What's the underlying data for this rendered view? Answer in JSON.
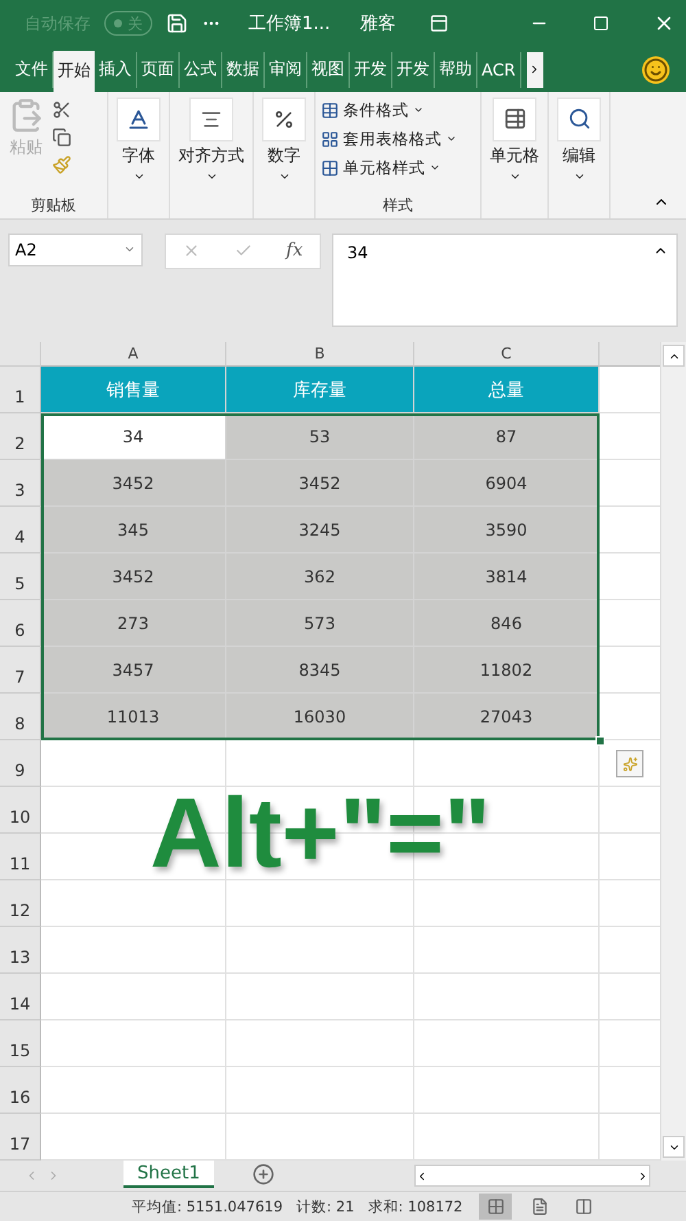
{
  "title_bar": {
    "autosave_label": "自动保存",
    "autosave_toggle": {
      "label": "关",
      "on": false
    },
    "title": "工作簿1...",
    "user": "雅客"
  },
  "ribbon_tabs": [
    {
      "label": "文件",
      "selected": false
    },
    {
      "label": "开始",
      "selected": true
    },
    {
      "label": "插入",
      "selected": false
    },
    {
      "label": "页面",
      "selected": false
    },
    {
      "label": "公式",
      "selected": false
    },
    {
      "label": "数据",
      "selected": false
    },
    {
      "label": "审阅",
      "selected": false
    },
    {
      "label": "视图",
      "selected": false
    },
    {
      "label": "开发",
      "selected": false
    },
    {
      "label": "开发",
      "selected": false
    },
    {
      "label": "帮助",
      "selected": false
    },
    {
      "label": "ACR",
      "selected": false
    }
  ],
  "ribbon": {
    "clipboard": {
      "paste": {
        "label": "粘贴",
        "disabled": true
      },
      "group_label": "剪贴板"
    },
    "big_buttons": [
      {
        "kind": "font",
        "label": "字体"
      },
      {
        "kind": "align",
        "label": "对齐方式"
      },
      {
        "kind": "number",
        "label": "数字"
      }
    ],
    "styles": {
      "items": [
        "条件格式",
        "套用表格格式",
        "单元格样式"
      ],
      "group_label": "样式"
    },
    "big_buttons_right": [
      {
        "kind": "cells",
        "label": "单元格"
      },
      {
        "kind": "edit",
        "label": "编辑"
      }
    ]
  },
  "formula_bar": {
    "name_box": "A2",
    "fx": "fx",
    "value": "34"
  },
  "columns": [
    "A",
    "B",
    "C"
  ],
  "rows": [
    {
      "number": "1",
      "kind": "header",
      "cells": [
        {
          "text": "销售量"
        },
        {
          "text": "库存量"
        },
        {
          "text": "总量"
        }
      ]
    },
    {
      "number": "2",
      "kind": "data",
      "cells": [
        {
          "text": "34",
          "selected": true,
          "active": true
        },
        {
          "text": "53",
          "selected": true,
          "active": false
        },
        {
          "text": "87",
          "selected": true,
          "active": false
        }
      ]
    },
    {
      "number": "3",
      "kind": "data",
      "cells": [
        {
          "text": "3452",
          "selected": true,
          "active": false
        },
        {
          "text": "3452",
          "selected": true,
          "active": false
        },
        {
          "text": "6904",
          "selected": true,
          "active": false
        }
      ]
    },
    {
      "number": "4",
      "kind": "data",
      "cells": [
        {
          "text": "345",
          "selected": true,
          "active": false
        },
        {
          "text": "3245",
          "selected": true,
          "active": false
        },
        {
          "text": "3590",
          "selected": true,
          "active": false
        }
      ]
    },
    {
      "number": "5",
      "kind": "data",
      "cells": [
        {
          "text": "3452",
          "selected": true,
          "active": false
        },
        {
          "text": "362",
          "selected": true,
          "active": false
        },
        {
          "text": "3814",
          "selected": true,
          "active": false
        }
      ]
    },
    {
      "number": "6",
      "kind": "data",
      "cells": [
        {
          "text": "273",
          "selected": true,
          "active": false
        },
        {
          "text": "573",
          "selected": true,
          "active": false
        },
        {
          "text": "846",
          "selected": true,
          "active": false
        }
      ]
    },
    {
      "number": "7",
      "kind": "data",
      "cells": [
        {
          "text": "3457",
          "selected": true,
          "active": false
        },
        {
          "text": "8345",
          "selected": true,
          "active": false
        },
        {
          "text": "11802",
          "selected": true,
          "active": false
        }
      ]
    },
    {
      "number": "8",
      "kind": "data",
      "cells": [
        {
          "text": "11013",
          "selected": true,
          "active": false
        },
        {
          "text": "16030",
          "selected": true,
          "active": false
        },
        {
          "text": "27043",
          "selected": true,
          "active": false
        }
      ]
    }
  ],
  "empty_rows": [
    "9",
    "10",
    "11",
    "12",
    "13",
    "14",
    "15",
    "16",
    "17"
  ],
  "overlay_caption": "Alt+\"=\"",
  "sheet_tabs": [
    {
      "label": "Sheet1",
      "selected": true
    }
  ],
  "status_bar": [
    "平均值: 5151.047619",
    "计数: 21",
    "求和: 108172"
  ],
  "view_buttons": [
    {
      "kind": "normal",
      "selected": true
    },
    {
      "kind": "page_layout",
      "selected": false
    },
    {
      "kind": "page_break",
      "selected": false
    }
  ]
}
